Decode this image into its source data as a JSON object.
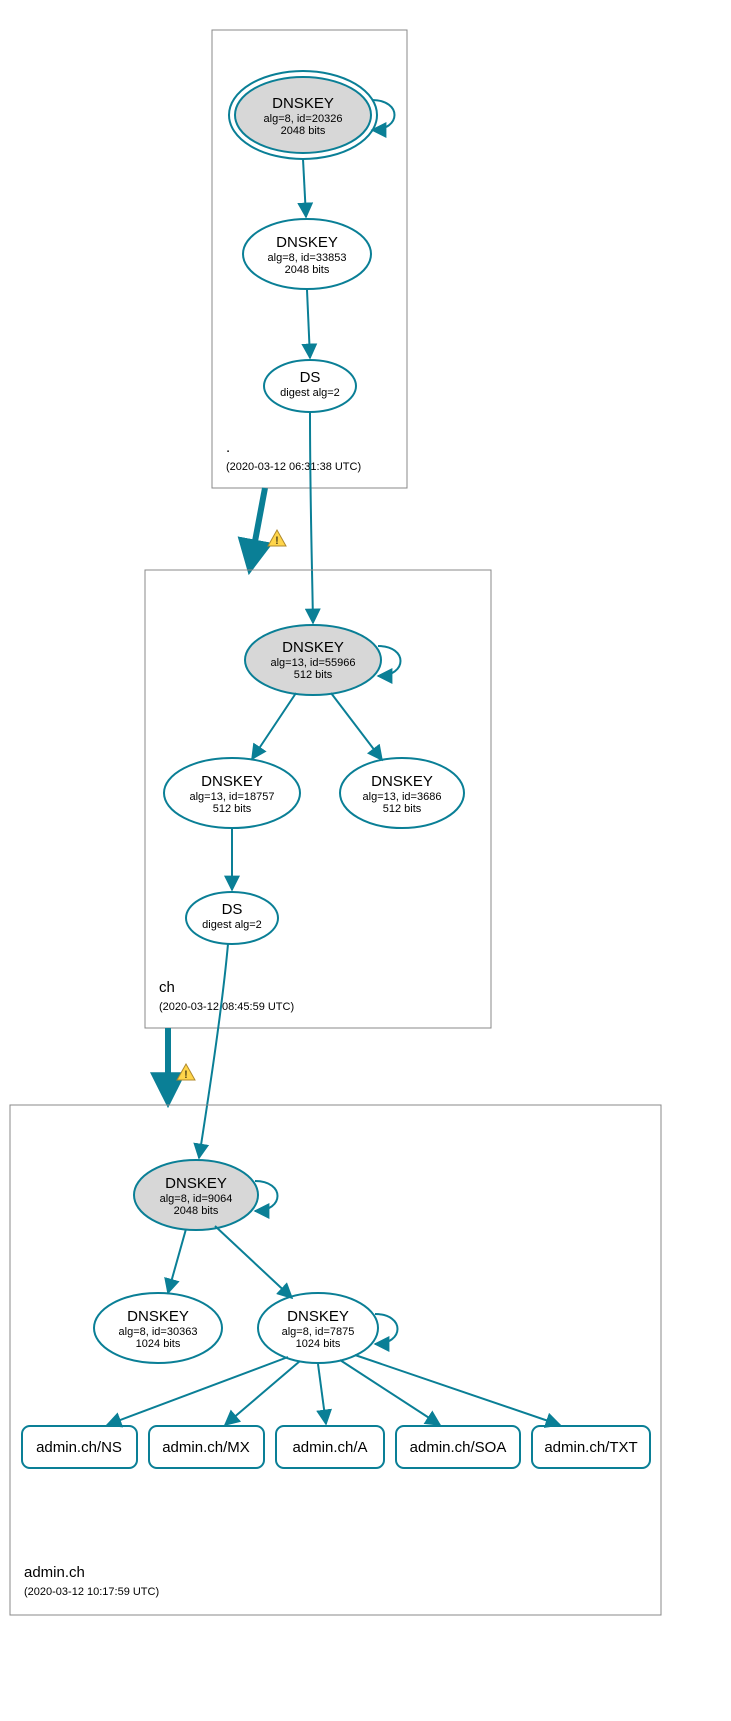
{
  "zones": {
    "root": {
      "name": ".",
      "timestamp": "(2020-03-12 06:31:38 UTC)"
    },
    "ch": {
      "name": "ch",
      "timestamp": "(2020-03-12 08:45:59 UTC)"
    },
    "admin": {
      "name": "admin.ch",
      "timestamp": "(2020-03-12 10:17:59 UTC)"
    }
  },
  "nodes": {
    "root_ksk": {
      "title": "DNSKEY",
      "l1": "alg=8, id=20326",
      "l2": "2048 bits"
    },
    "root_zsk": {
      "title": "DNSKEY",
      "l1": "alg=8, id=33853",
      "l2": "2048 bits"
    },
    "root_ds": {
      "title": "DS",
      "l1": "digest alg=2"
    },
    "ch_ksk": {
      "title": "DNSKEY",
      "l1": "alg=13, id=55966",
      "l2": "512 bits"
    },
    "ch_zsk1": {
      "title": "DNSKEY",
      "l1": "alg=13, id=18757",
      "l2": "512 bits"
    },
    "ch_zsk2": {
      "title": "DNSKEY",
      "l1": "alg=13, id=3686",
      "l2": "512 bits"
    },
    "ch_ds": {
      "title": "DS",
      "l1": "digest alg=2"
    },
    "adm_ksk": {
      "title": "DNSKEY",
      "l1": "alg=8, id=9064",
      "l2": "2048 bits"
    },
    "adm_zsk1": {
      "title": "DNSKEY",
      "l1": "alg=8, id=30363",
      "l2": "1024 bits"
    },
    "adm_zsk2": {
      "title": "DNSKEY",
      "l1": "alg=8, id=7875",
      "l2": "1024 bits"
    }
  },
  "rrsets": {
    "ns": "admin.ch/NS",
    "mx": "admin.ch/MX",
    "a": "admin.ch/A",
    "soa": "admin.ch/SOA",
    "txt": "admin.ch/TXT"
  }
}
